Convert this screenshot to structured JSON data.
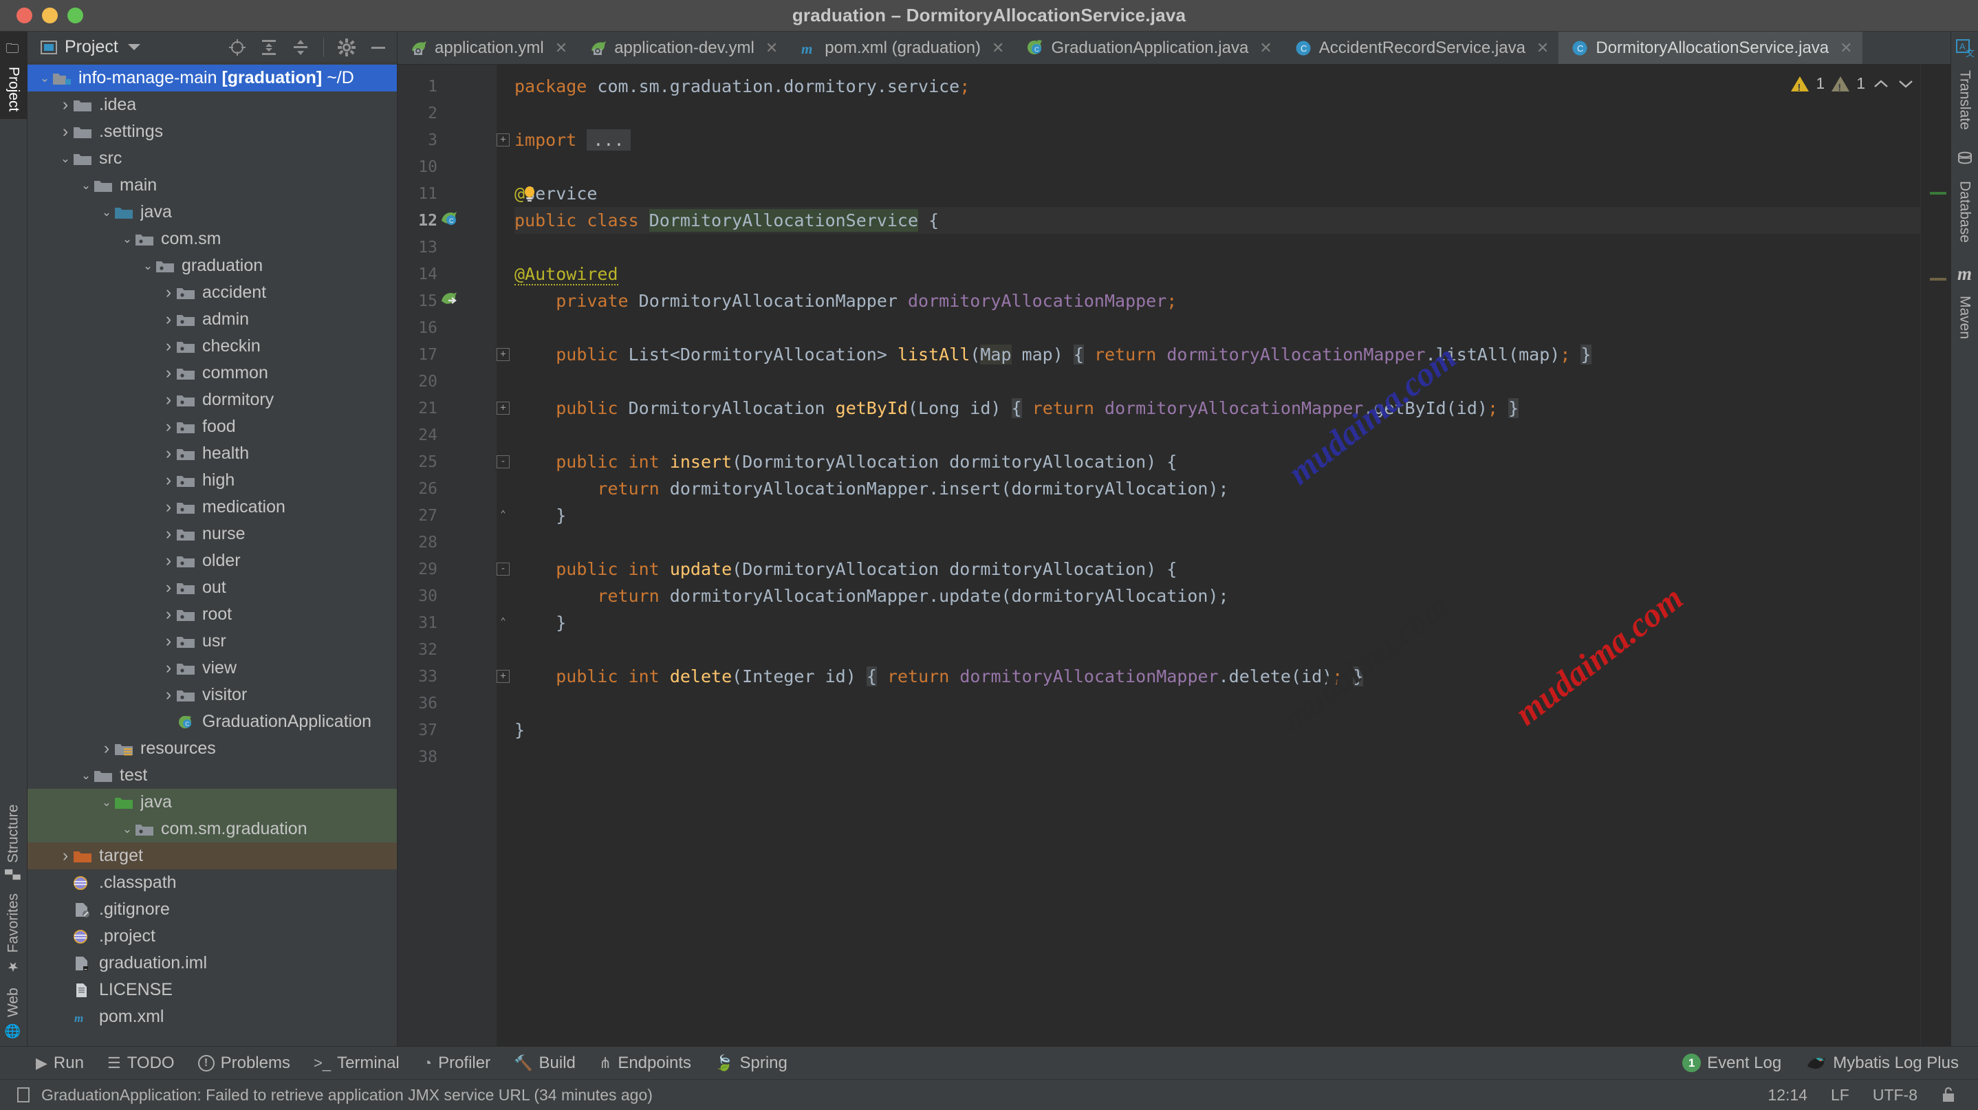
{
  "window": {
    "title": "graduation – DormitoryAllocationService.java",
    "traffic_lights": [
      "close",
      "minimize",
      "maximize"
    ]
  },
  "left_rail": {
    "top": [
      {
        "label": "Project",
        "icon": "folder-icon",
        "active": true
      }
    ],
    "bottom": [
      {
        "label": "Structure",
        "icon": "structure-icon"
      },
      {
        "label": "Favorites",
        "icon": "star-icon"
      },
      {
        "label": "Web",
        "icon": "globe-icon"
      }
    ]
  },
  "project_panel": {
    "title": "Project",
    "tools": [
      "locate-icon",
      "expand-all-icon",
      "collapse-all-icon",
      "gear-icon",
      "hide-icon"
    ],
    "tree": [
      {
        "label": "info-manage-main [graduation] ~/D",
        "bold_part": "[graduation]",
        "depth": 0,
        "arrow": "down",
        "icon": "module-icon",
        "state": "selected"
      },
      {
        "label": ".idea",
        "depth": 1,
        "arrow": "right",
        "icon": "folder-icon"
      },
      {
        "label": ".settings",
        "depth": 1,
        "arrow": "right",
        "icon": "folder-icon"
      },
      {
        "label": "src",
        "depth": 1,
        "arrow": "down",
        "icon": "folder-icon"
      },
      {
        "label": "main",
        "depth": 2,
        "arrow": "down",
        "icon": "folder-icon"
      },
      {
        "label": "java",
        "depth": 3,
        "arrow": "down",
        "icon": "source-folder-icon"
      },
      {
        "label": "com.sm",
        "depth": 4,
        "arrow": "down",
        "icon": "package-icon"
      },
      {
        "label": "graduation",
        "depth": 5,
        "arrow": "down",
        "icon": "package-icon"
      },
      {
        "label": "accident",
        "depth": 6,
        "arrow": "right",
        "icon": "package-icon"
      },
      {
        "label": "admin",
        "depth": 6,
        "arrow": "right",
        "icon": "package-icon"
      },
      {
        "label": "checkin",
        "depth": 6,
        "arrow": "right",
        "icon": "package-icon"
      },
      {
        "label": "common",
        "depth": 6,
        "arrow": "right",
        "icon": "package-icon"
      },
      {
        "label": "dormitory",
        "depth": 6,
        "arrow": "right",
        "icon": "package-icon"
      },
      {
        "label": "food",
        "depth": 6,
        "arrow": "right",
        "icon": "package-icon"
      },
      {
        "label": "health",
        "depth": 6,
        "arrow": "right",
        "icon": "package-icon"
      },
      {
        "label": "high",
        "depth": 6,
        "arrow": "right",
        "icon": "package-icon"
      },
      {
        "label": "medication",
        "depth": 6,
        "arrow": "right",
        "icon": "package-icon"
      },
      {
        "label": "nurse",
        "depth": 6,
        "arrow": "right",
        "icon": "package-icon"
      },
      {
        "label": "older",
        "depth": 6,
        "arrow": "right",
        "icon": "package-icon"
      },
      {
        "label": "out",
        "depth": 6,
        "arrow": "right",
        "icon": "package-icon"
      },
      {
        "label": "root",
        "depth": 6,
        "arrow": "right",
        "icon": "package-icon"
      },
      {
        "label": "usr",
        "depth": 6,
        "arrow": "right",
        "icon": "package-icon"
      },
      {
        "label": "view",
        "depth": 6,
        "arrow": "right",
        "icon": "package-icon"
      },
      {
        "label": "visitor",
        "depth": 6,
        "arrow": "right",
        "icon": "package-icon"
      },
      {
        "label": "GraduationApplication",
        "depth": 6,
        "arrow": "none",
        "icon": "spring-class-icon"
      },
      {
        "label": "resources",
        "depth": 3,
        "arrow": "right",
        "icon": "resource-folder-icon"
      },
      {
        "label": "test",
        "depth": 2,
        "arrow": "down",
        "icon": "folder-icon"
      },
      {
        "label": "java",
        "depth": 3,
        "arrow": "down",
        "icon": "test-source-folder-icon",
        "state": "green"
      },
      {
        "label": "com.sm.graduation",
        "depth": 4,
        "arrow": "down",
        "icon": "package-icon",
        "state": "green"
      },
      {
        "label": "target",
        "depth": 1,
        "arrow": "right",
        "icon": "excluded-folder-icon",
        "state": "brown"
      },
      {
        "label": ".classpath",
        "depth": 1,
        "arrow": "none",
        "icon": "xml-file-icon"
      },
      {
        "label": ".gitignore",
        "depth": 1,
        "arrow": "none",
        "icon": "gitignore-file-icon"
      },
      {
        "label": ".project",
        "depth": 1,
        "arrow": "none",
        "icon": "xml-file-icon"
      },
      {
        "label": "graduation.iml",
        "depth": 1,
        "arrow": "none",
        "icon": "iml-file-icon"
      },
      {
        "label": "LICENSE",
        "depth": 1,
        "arrow": "none",
        "icon": "text-file-icon"
      },
      {
        "label": "pom.xml",
        "depth": 1,
        "arrow": "none",
        "icon": "maven-file-icon"
      }
    ]
  },
  "editor_tabs": [
    {
      "label": "application.yml",
      "icon": "spring-yaml-icon",
      "active": false,
      "closable": true
    },
    {
      "label": "application-dev.yml",
      "icon": "spring-yaml-icon",
      "active": false,
      "closable": true
    },
    {
      "label": "pom.xml (graduation)",
      "icon": "maven-icon",
      "active": false,
      "closable": true
    },
    {
      "label": "GraduationApplication.java",
      "icon": "spring-class-icon",
      "active": false,
      "closable": true
    },
    {
      "label": "AccidentRecordService.java",
      "icon": "class-icon",
      "active": false,
      "closable": true
    },
    {
      "label": "DormitoryAllocationService.java",
      "icon": "class-icon",
      "active": true,
      "closable": true
    }
  ],
  "inspection_widget": {
    "warning_count": "1",
    "weak_warning_count": "1",
    "collapse_icon": "chevron-up-icon",
    "expand_icon": "chevron-down-icon"
  },
  "editor": {
    "filename": "DormitoryAllocationService.java",
    "line_numbers": [
      "1",
      "2",
      "3",
      "10",
      "11",
      "12",
      "13",
      "14",
      "15",
      "16",
      "17",
      "20",
      "21",
      "24",
      "25",
      "26",
      "27",
      "28",
      "29",
      "30",
      "31",
      "32",
      "33",
      "36",
      "37",
      "38"
    ],
    "gutter_marks": {
      "12": "spring-bean-icon",
      "15": "spring-autowired-icon"
    },
    "code_lines": [
      "package com.sm.graduation.dormitory.service;",
      "",
      "import ...",
      "",
      "@Service",
      "public class DormitoryAllocationService {",
      "",
      "    @Autowired",
      "    private DormitoryAllocationMapper dormitoryAllocationMapper;",
      "",
      "    public List<DormitoryAllocation> listAll(Map map) { return dormitoryAllocationMapper.listAll(map); }",
      "",
      "    public DormitoryAllocation getById(Long id) { return dormitoryAllocationMapper.getById(id); }",
      "",
      "    public int insert(DormitoryAllocation dormitoryAllocation) {",
      "        return dormitoryAllocationMapper.insert(dormitoryAllocation);",
      "    }",
      "",
      "    public int update(DormitoryAllocation dormitoryAllocation) {",
      "        return dormitoryAllocationMapper.update(dormitoryAllocation);",
      "    }",
      "",
      "    public int delete(Integer id) { return dormitoryAllocationMapper.delete(id); }",
      "",
      "}",
      ""
    ]
  },
  "watermarks": [
    "mudaima.com",
    "mudaima.com",
    "mudaima.com"
  ],
  "right_rail": [
    {
      "label": "Translate",
      "icon": "translate-icon"
    },
    {
      "label": "Database",
      "icon": "database-icon"
    },
    {
      "label": "Maven",
      "icon": "maven-icon"
    }
  ],
  "bottom_toolwindows": [
    {
      "label": "Run",
      "icon": "run-icon"
    },
    {
      "label": "TODO",
      "icon": "todo-icon"
    },
    {
      "label": "Problems",
      "icon": "problems-icon"
    },
    {
      "label": "Terminal",
      "icon": "terminal-icon"
    },
    {
      "label": "Profiler",
      "icon": "profiler-icon"
    },
    {
      "label": "Build",
      "icon": "build-icon"
    },
    {
      "label": "Endpoints",
      "icon": "endpoints-icon"
    },
    {
      "label": "Spring",
      "icon": "spring-icon"
    }
  ],
  "bottom_right": {
    "event_log_count": "1",
    "event_log_label": "Event Log",
    "mybatis_label": "Mybatis Log Plus",
    "mybatis_icon": "bird-icon"
  },
  "status_bar": {
    "message": "GraduationApplication: Failed to retrieve application JMX service URL (34 minutes ago)",
    "message_icon": "notification-icon",
    "time": "12:14",
    "line_separator": "LF",
    "encoding": "UTF-8",
    "lock_icon": "unlocked-icon"
  },
  "colors": {
    "titlebar_bg": "#4b4b4b",
    "panel_bg": "#3c3f41",
    "editor_bg": "#2b2b2b",
    "gutter_bg": "#313335",
    "selection_blue": "#2f65ca",
    "keyword_orange": "#cc7832",
    "method_yellow": "#ffc66d",
    "field_purple": "#9876aa",
    "annotation_olive": "#bbb529",
    "text_grey": "#a9b7c6"
  }
}
